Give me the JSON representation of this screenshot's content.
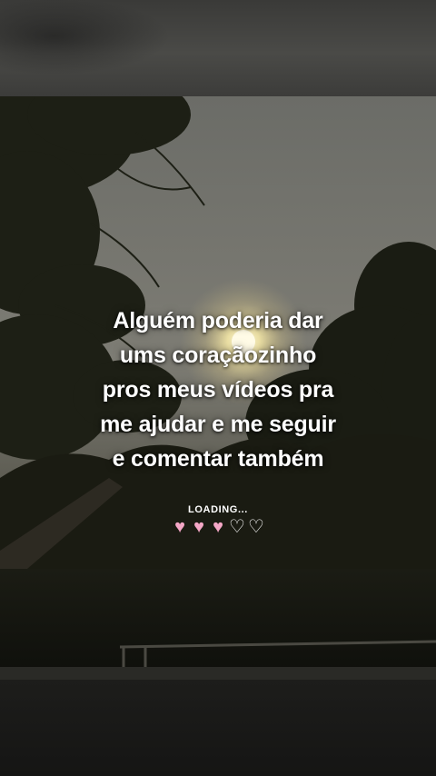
{
  "caption": {
    "lines": [
      "Alguém poderia dar",
      "ums coraçãozinho",
      "pros meus vídeos pra",
      "me ajudar e me seguir",
      "e comentar também"
    ]
  },
  "loader": {
    "label": "LOADING...",
    "hearts_filled": 3,
    "hearts_total": 5,
    "glyphs": [
      "♥",
      "♥",
      "♥",
      "♡",
      "♡"
    ],
    "filled_color": "#f4a7c6",
    "empty_color": "#ffffff"
  }
}
